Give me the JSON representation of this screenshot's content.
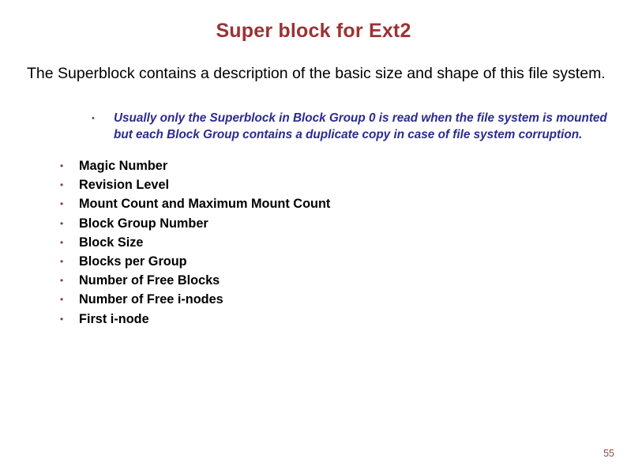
{
  "slide": {
    "title": "Super block for Ext2",
    "lead_paragraph": "The Superblock contains a description of the basic size and shape of this file system.",
    "sub_bullet": {
      "marker": "•",
      "text": "Usually only the Superblock in Block Group 0 is read when the file system is mounted but each Block Group contains a duplicate copy in case of file system corruption."
    },
    "bullets": [
      {
        "marker": "•",
        "label": "Magic Number"
      },
      {
        "marker": "•",
        "label": "Revision Level"
      },
      {
        "marker": "•",
        "label": "Mount Count and Maximum Mount Count"
      },
      {
        "marker": "•",
        "label": "Block Group Number"
      },
      {
        "marker": "•",
        "label": "Block Size"
      },
      {
        "marker": "•",
        "label": "Blocks per Group"
      },
      {
        "marker": "•",
        "label": "Number of Free Blocks"
      },
      {
        "marker": "•",
        "label": "Number of Free i-nodes"
      },
      {
        "marker": "•",
        "label": "First i-node"
      }
    ],
    "page_number": "55",
    "colors": {
      "title": "#9a3334",
      "body_text": "#000000",
      "sub_bullet_text": "#2b2b8f",
      "bullet_marker": "#7b4040",
      "page_number": "#8d4a4a",
      "background": "#ffffff"
    }
  }
}
